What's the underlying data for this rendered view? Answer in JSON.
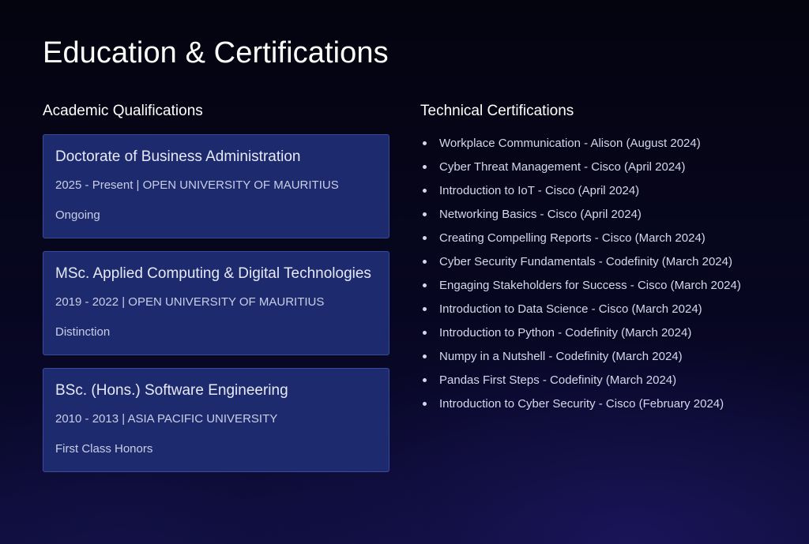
{
  "page": {
    "title": "Education & Certifications"
  },
  "academic": {
    "heading": "Academic Qualifications",
    "items": [
      {
        "title": "Doctorate of Business Administration",
        "meta": "2025 - Present | OPEN UNIVERSITY OF MAURITIUS",
        "status": "Ongoing"
      },
      {
        "title": "MSc. Applied Computing & Digital Technologies",
        "meta": "2019 - 2022 | OPEN UNIVERSITY OF MAURITIUS",
        "status": "Distinction"
      },
      {
        "title": "BSc. (Hons.) Software Engineering",
        "meta": "2010 - 2013 | ASIA PACIFIC UNIVERSITY",
        "status": "First Class Honors"
      }
    ]
  },
  "certifications": {
    "heading": "Technical Certifications",
    "items": [
      "Workplace Communication - Alison (August 2024)",
      "Cyber Threat Management - Cisco (April 2024)",
      "Introduction to IoT - Cisco (April 2024)",
      "Networking Basics - Cisco (April 2024)",
      "Creating Compelling Reports - Cisco (March 2024)",
      "Cyber Security Fundamentals - Codefinity (March 2024)",
      "Engaging Stakeholders for Success - Cisco (March 2024)",
      "Introduction to Data Science - Cisco (March 2024)",
      "Introduction to Python - Codefinity (March 2024)",
      "Numpy in a Nutshell - Codefinity (March 2024)",
      "Pandas First Steps - Codefinity (March 2024)",
      "Introduction to Cyber Security - Cisco (February 2024)"
    ]
  },
  "colors": {
    "card_background": "#1d2a6e",
    "card_border": "#3a4a9a",
    "page_background": "#05051a"
  }
}
